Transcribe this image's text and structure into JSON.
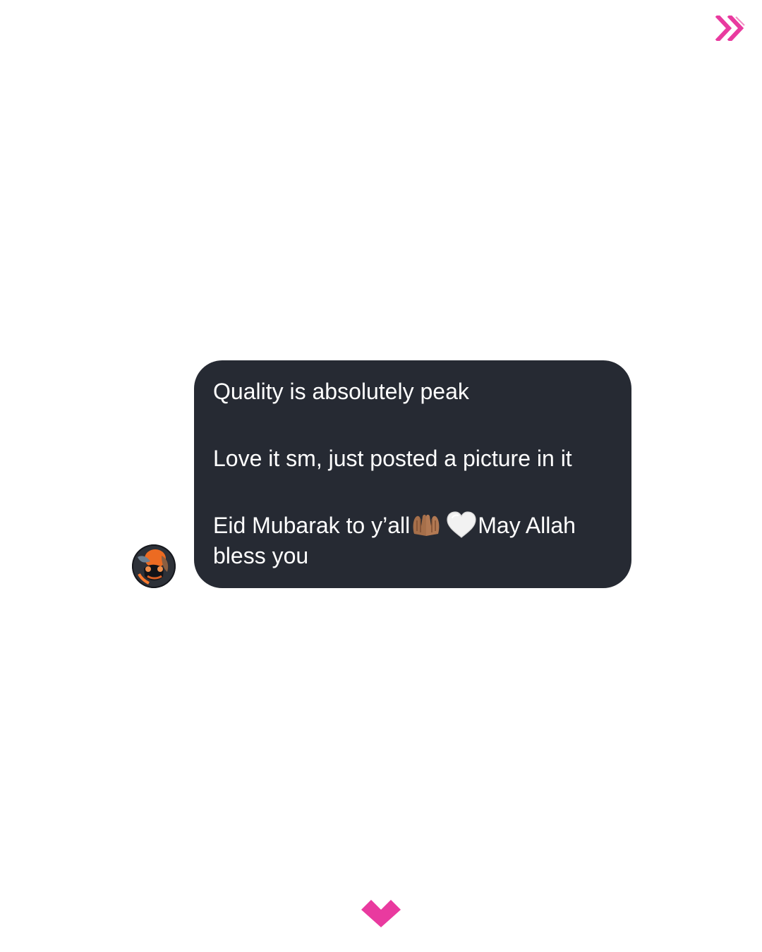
{
  "navigation": {
    "next_icon": "double-chevron-right-icon",
    "down_icon": "chevron-down-icon",
    "accent_color": "#e93a9f"
  },
  "conversation": {
    "sender_avatar": "profile-avatar",
    "bubble_color": "#262a33",
    "message": {
      "line_1": "Quality is absolutely peak",
      "line_2": "Love it sm, just posted a picture in it",
      "line_3_before_emoji": "Eid Mubarak to y’all",
      "emoji_hands": "🤲🏽",
      "emoji_heart": "🤍",
      "line_3_after_emoji": "May Allah bless you"
    }
  }
}
